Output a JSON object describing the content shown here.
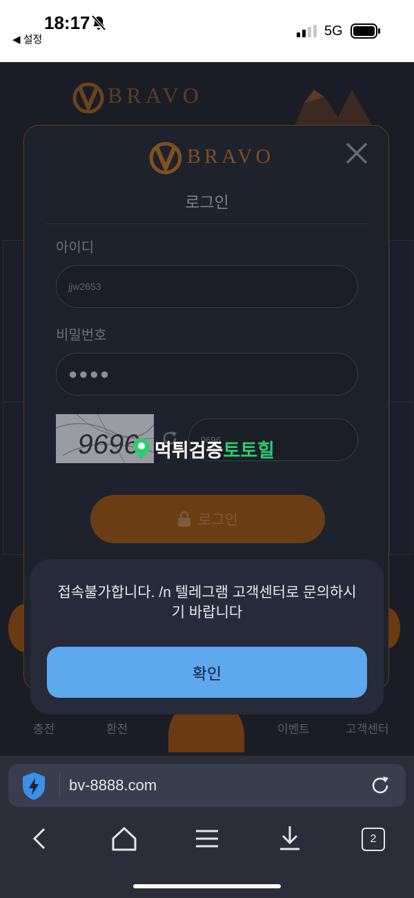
{
  "status_bar": {
    "time": "18:17",
    "back_app": "◀ 설정",
    "network": "5G"
  },
  "site": {
    "brand": "BRAVO",
    "nav": [
      {
        "label": "충전"
      },
      {
        "label": "환전"
      },
      {
        "label": "이벤트"
      },
      {
        "label": "고객센터"
      }
    ]
  },
  "login_modal": {
    "brand": "BRAVO",
    "title": "로그인",
    "id_label": "아이디",
    "id_value": "jjw2653",
    "pw_label": "비밀번호",
    "pw_value": "●●●●",
    "captcha_image_text": "9696",
    "captcha_value": "9696",
    "login_button": "로그인"
  },
  "watermark": {
    "part1": "먹튀검증",
    "part2": "토토힐"
  },
  "alert": {
    "message": "접속불가합니다. /n 텔레그램 고객센터로 문의하시기 바랍니다",
    "confirm": "확인"
  },
  "browser": {
    "url": "bv-8888.com",
    "tab_count": "2"
  },
  "colors": {
    "accent": "#5ea8ee",
    "brand_orange": "#e07a1f",
    "watermark_green": "#2ecc71"
  }
}
